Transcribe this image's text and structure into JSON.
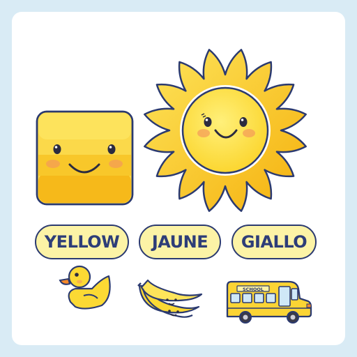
{
  "colors": {
    "background": "#d9ebf5",
    "card": "#ffffff",
    "yellow": "#fbd932",
    "outline": "#2b3a70",
    "label_fill": "#fcf3a6"
  },
  "words": {
    "english": "YELLOW",
    "french": "JAUNE",
    "italian": "GIALLO"
  },
  "bus_sign": "SCHOOL",
  "icons": [
    "smiling-yellow-square",
    "smiling-sun",
    "rubber-duck",
    "bananas",
    "school-bus"
  ]
}
